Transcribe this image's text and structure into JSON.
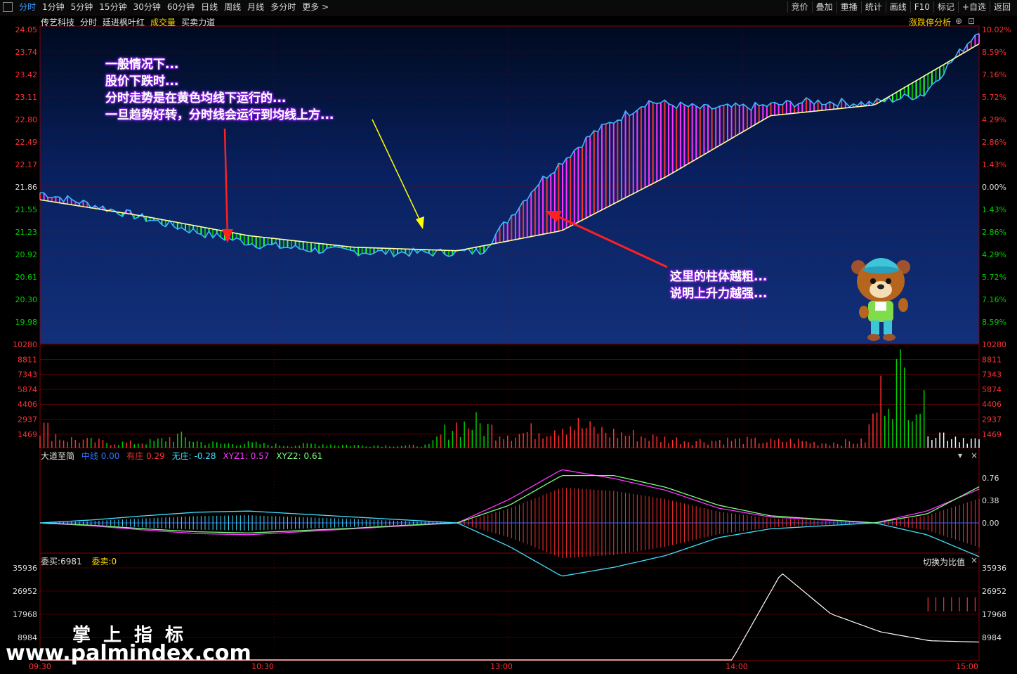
{
  "toolbar": {
    "left_items": [
      "分时",
      "1分钟",
      "5分钟",
      "15分钟",
      "30分钟",
      "60分钟",
      "日线",
      "周线",
      "月线",
      "多分时",
      "更多 >"
    ],
    "right_items": [
      "竞价",
      "叠加",
      "重播",
      "统计",
      "画线",
      "F10",
      "标记",
      "+自选",
      "返回"
    ]
  },
  "header": {
    "stock_name": "传艺科技",
    "mode": "分时",
    "indicator": "廷进枫叶红",
    "volume_label": "成交量",
    "power_label": "买卖力道",
    "limit_analysis": "涨跌停分析"
  },
  "price_axis": {
    "left_ticks": [
      "24.05",
      "23.74",
      "23.42",
      "23.11",
      "22.80",
      "22.49",
      "22.17",
      "21.86",
      "21.55",
      "21.23",
      "20.92",
      "20.61",
      "20.30",
      "19.98"
    ],
    "right_ticks": [
      "10.02%",
      "8.59%",
      "7.16%",
      "5.72%",
      "4.29%",
      "2.86%",
      "1.43%",
      "0.00%",
      "1.43%",
      "2.86%",
      "4.29%",
      "5.72%",
      "7.16%",
      "8.59%"
    ]
  },
  "volume_axis": {
    "ticks": [
      "10280",
      "8811",
      "7343",
      "5874",
      "4406",
      "2937",
      "1469"
    ]
  },
  "indicator_panel": {
    "name": "大道至简",
    "zhongxian_label": "中线",
    "zhongxian_value": "0.00",
    "youzhuang_label": "有庄",
    "youzhuang_value": "0.29",
    "wuzhuang_label": "无庄",
    "wuzhuang_value": "-0.28",
    "xyz1_label": "XYZ1",
    "xyz1_value": "0.57",
    "xyz2_label": "XYZ2",
    "xyz2_value": "0.61",
    "ticks": [
      "0.76",
      "0.38",
      "0.00"
    ]
  },
  "order_panel": {
    "buy_label": "委买",
    "buy_value": "6981",
    "sell_label": "委卖",
    "sell_value": "0",
    "switch_label": "切换为比值",
    "ticks": [
      "35936",
      "26952",
      "17968",
      "8984"
    ]
  },
  "time_axis": [
    "09:30",
    "10:30",
    "13:00",
    "14:00",
    "15:00"
  ],
  "annotations": {
    "top_left": [
      "一般情况下...",
      "股价下跌时...",
      "分时走势是在黄色均线下运行的...",
      "一旦趋势好转，分时线会运行到均线上方..."
    ],
    "right": [
      "这里的柱体越粗...",
      "说明上升力越强..."
    ]
  },
  "watermark": {
    "cn": "掌上指标",
    "url": "www.palmindex.com"
  },
  "colors": {
    "up": "#ff3030",
    "down": "#00e000",
    "price_line": "#3ab8ff",
    "avg_line": "#ffffa0",
    "magenta": "#ff33ff",
    "cyan": "#40e0ff",
    "grid": "#8b0000"
  },
  "chart_data": [
    {
      "type": "line",
      "title": "",
      "series": [
        {
          "name": "",
          "x": [
            "09:30",
            "09:45",
            "10:00",
            "10:15",
            "10:30",
            "10:45",
            "11:00",
            "11:15",
            "11:30",
            "13:00",
            "13:15",
            "13:30",
            "13:45",
            "14:00",
            "14:15",
            "14:30",
            "14:45",
            "15:00"
          ],
          "values": [
            21.78,
            21.6,
            21.4,
            21.2,
            21.05,
            20.98,
            20.95,
            20.94,
            20.96,
            21.9,
            22.6,
            23.05,
            22.95,
            22.98,
            23.05,
            23.02,
            23.15,
            24.05
          ]
        },
        {
          "name": "",
          "x": [
            "09:30",
            "10:00",
            "10:30",
            "11:00",
            "11:30",
            "13:00",
            "13:30",
            "14:00",
            "14:30",
            "15:00"
          ],
          "values": [
            21.68,
            21.45,
            21.18,
            21.02,
            20.97,
            21.25,
            22.0,
            22.85,
            23.0,
            23.85
          ]
        }
      ],
      "ylim": [
        19.83,
        24.05
      ],
      "ylabel": ""
    },
    {
      "type": "bar",
      "title": "",
      "series": [
        {
          "name": "",
          "values": [
            2900,
            1200,
            900,
            700,
            600,
            800,
            1500,
            700,
            500,
            600,
            400,
            300,
            500,
            400,
            300,
            300,
            250,
            300,
            2900,
            3100,
            2200,
            1800,
            2500,
            3300,
            2400,
            1900,
            1600,
            1200,
            1000,
            900,
            1000,
            900,
            800,
            900,
            600,
            700,
            800,
            9200,
            8900,
            2000,
            1500,
            900
          ]
        }
      ],
      "ylim": [
        0,
        10280
      ]
    },
    {
      "type": "line",
      "title": "",
      "series": [
        {
          "name": "XYZ1",
          "values": [
            0,
            -0.05,
            -0.12,
            -0.18,
            -0.2,
            -0.15,
            -0.1,
            -0.05,
            0,
            0.4,
            0.9,
            0.75,
            0.55,
            0.25,
            0.1,
            0.05,
            0,
            0.2,
            0.57
          ]
        },
        {
          "name": "XYZ2",
          "values": [
            0,
            -0.04,
            -0.1,
            -0.15,
            -0.17,
            -0.13,
            -0.09,
            -0.04,
            0,
            0.3,
            0.8,
            0.8,
            0.6,
            0.3,
            0.12,
            0.06,
            0,
            0.15,
            0.61
          ]
        }
      ],
      "ylim": [
        -0.8,
        0.95
      ]
    },
    {
      "type": "line",
      "title": "",
      "series": [
        {
          "name": "委买",
          "values": [
            0,
            0,
            0,
            0,
            0,
            0,
            0,
            0,
            0,
            0,
            0,
            0,
            0,
            0,
            0,
            34000,
            18000,
            11000,
            7500,
            6981
          ]
        }
      ],
      "ylim": [
        0,
        35936
      ]
    }
  ]
}
